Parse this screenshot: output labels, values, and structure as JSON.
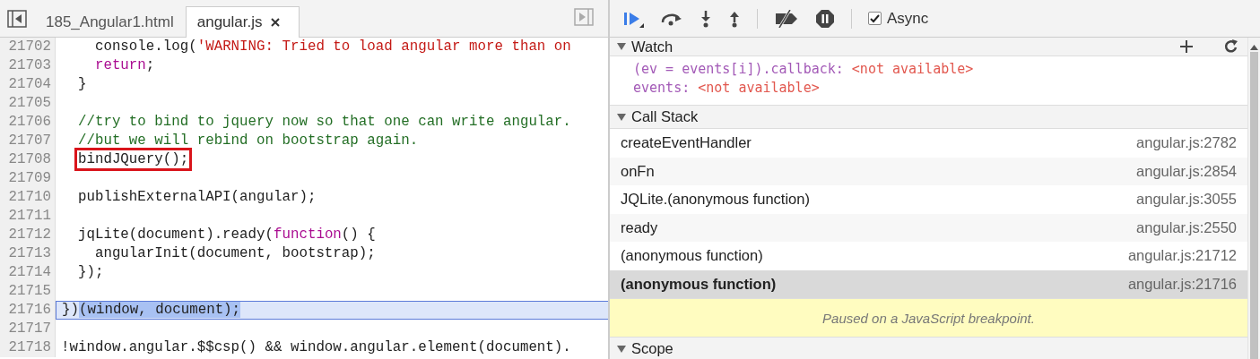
{
  "editor": {
    "tabs": [
      {
        "label": "185_Angular1.html",
        "selected": false,
        "closable": false
      },
      {
        "label": "angular.js",
        "selected": true,
        "closable": true
      }
    ],
    "lines": [
      {
        "number": "21702",
        "current": false,
        "segments": [
          {
            "kind": "plain",
            "text": "    console.log("
          },
          {
            "kind": "string",
            "text": "'WARNING: Tried to load angular more than on"
          }
        ]
      },
      {
        "number": "21703",
        "current": false,
        "segments": [
          {
            "kind": "keyword",
            "text": "    return"
          },
          {
            "kind": "plain",
            "text": ";"
          }
        ]
      },
      {
        "number": "21704",
        "current": false,
        "segments": [
          {
            "kind": "plain",
            "text": "  }"
          }
        ]
      },
      {
        "number": "21705",
        "current": false
      },
      {
        "number": "21706",
        "current": false,
        "segments": [
          {
            "kind": "comment",
            "text": "  //try to bind to jquery now so that one can write angular."
          }
        ]
      },
      {
        "number": "21707",
        "current": false,
        "segments": [
          {
            "kind": "comment",
            "text": "  //but we will rebind on bootstrap again."
          }
        ]
      },
      {
        "number": "21708",
        "current": false,
        "segments": [
          {
            "kind": "boxed",
            "text": "  bindJQuery();"
          }
        ]
      },
      {
        "number": "21709",
        "current": false
      },
      {
        "number": "21710",
        "current": false,
        "segments": [
          {
            "kind": "plain",
            "text": "  publishExternalAPI(angular);"
          }
        ]
      },
      {
        "number": "21711",
        "current": false
      },
      {
        "number": "21712",
        "current": false,
        "segments": [
          {
            "kind": "plain",
            "text": "  jqLite(document).ready("
          },
          {
            "kind": "keyword",
            "text": "function"
          },
          {
            "kind": "plain",
            "text": "() {"
          }
        ]
      },
      {
        "number": "21713",
        "current": false,
        "segments": [
          {
            "kind": "plain",
            "text": "    angularInit(document, bootstrap);"
          }
        ]
      },
      {
        "number": "21714",
        "current": false,
        "segments": [
          {
            "kind": "plain",
            "text": "  });"
          }
        ]
      },
      {
        "number": "21715",
        "current": false
      },
      {
        "number": "21716",
        "current": true,
        "segments": [
          {
            "kind": "plain",
            "text": "})"
          },
          {
            "kind": "selection",
            "text": "(window, document);"
          }
        ]
      },
      {
        "number": "21717",
        "current": false
      },
      {
        "number": "21718",
        "current": false,
        "segments": [
          {
            "kind": "plain",
            "text": "!window.angular.$$csp() && window.angular.element(document)."
          }
        ]
      }
    ]
  },
  "debugger": {
    "async": {
      "label": "Async",
      "checked": true
    },
    "watch": {
      "title": "Watch",
      "expanded": true,
      "expressions": [
        {
          "expression": "(ev = events[i]).callback:",
          "value": "<not available>"
        },
        {
          "expression": "events:",
          "value": "<not available>"
        }
      ]
    },
    "call_stack": {
      "title": "Call Stack",
      "expanded": true,
      "frames": [
        {
          "name": "createEventHandler",
          "location": "angular.js:2782",
          "selected": false
        },
        {
          "name": "onFn",
          "location": "angular.js:2854",
          "selected": false
        },
        {
          "name": "JQLite.(anonymous function)",
          "location": "angular.js:3055",
          "selected": false
        },
        {
          "name": "ready",
          "location": "angular.js:2550",
          "selected": false
        },
        {
          "name": "(anonymous function)",
          "location": "angular.js:21712",
          "selected": false
        },
        {
          "name": "(anonymous function)",
          "location": "angular.js:21716",
          "selected": true
        }
      ]
    },
    "paused_message": "Paused on a JavaScript breakpoint.",
    "scope": {
      "title": "Scope",
      "expanded": true
    }
  }
}
